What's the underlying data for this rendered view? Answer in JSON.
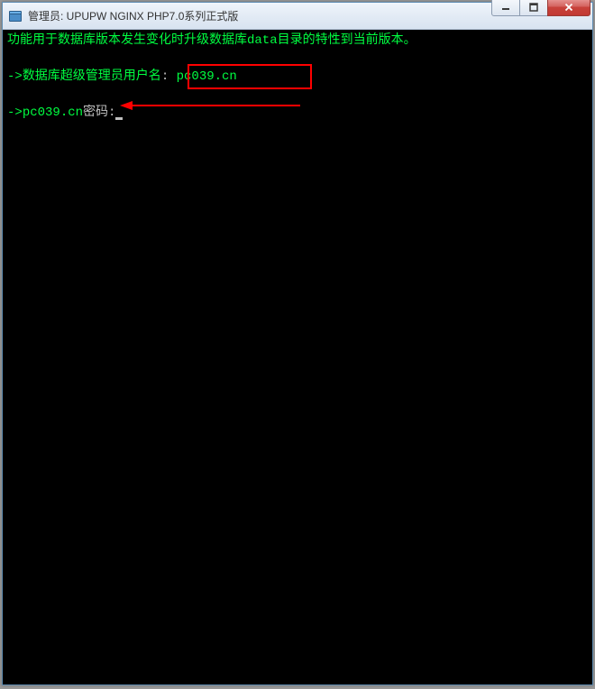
{
  "window": {
    "title": "管理员:    UPUPW NGINX PHP7.0系列正式版"
  },
  "terminal": {
    "line1_prefix": "  功",
    "line1_text": "能用于数据库版本发生变化时升级数据库data目录的特性到当前版本。",
    "line2_prefix": "->",
    "line2_text": "数据库超级管理员用户名",
    "line2_colon": ":",
    "line2_value": "pc039.cn",
    "line3_prefix": "->",
    "line3_user": "pc039.cn",
    "line3_label": "密码",
    "line3_colon": ":"
  }
}
